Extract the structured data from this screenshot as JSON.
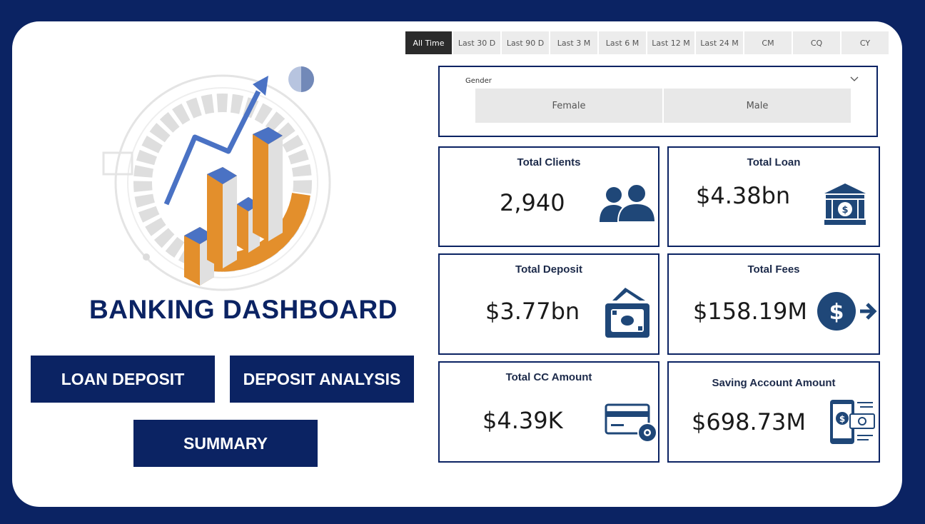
{
  "time_filters": [
    "All Time",
    "Last 30 D",
    "Last 90 D",
    "Last 3 M",
    "Last 6 M",
    "Last 12 M",
    "Last 24 M",
    "CM",
    "CQ",
    "CY"
  ],
  "active_time_filter": "All Time",
  "gender_slicer": {
    "label": "Gender",
    "options": [
      "Female",
      "Male"
    ]
  },
  "title": "BANKING DASHBOARD",
  "nav_buttons": {
    "loan_deposit": "LOAN DEPOSIT",
    "deposit_analysis": "DEPOSIT ANALYSIS",
    "summary": "SUMMARY"
  },
  "kpis": {
    "total_clients": {
      "label": "Total Clients",
      "value": "2,940"
    },
    "total_loan": {
      "label": "Total Loan",
      "value": "$4.38bn"
    },
    "total_deposit": {
      "label": "Total Deposit",
      "value": "$3.77bn"
    },
    "total_fees": {
      "label": "Total Fees",
      "value": "$158.19M"
    },
    "total_cc_amount": {
      "label": "Total CC Amount",
      "value": "$4.39K"
    },
    "saving_account_amount": {
      "label": "Saving Account Amount",
      "value": "$698.73M"
    }
  },
  "colors": {
    "navy": "#0b2363",
    "kpi_icon": "#1f4778",
    "chart_orange": "#e38f2c",
    "chart_blue": "#4a72c4"
  }
}
